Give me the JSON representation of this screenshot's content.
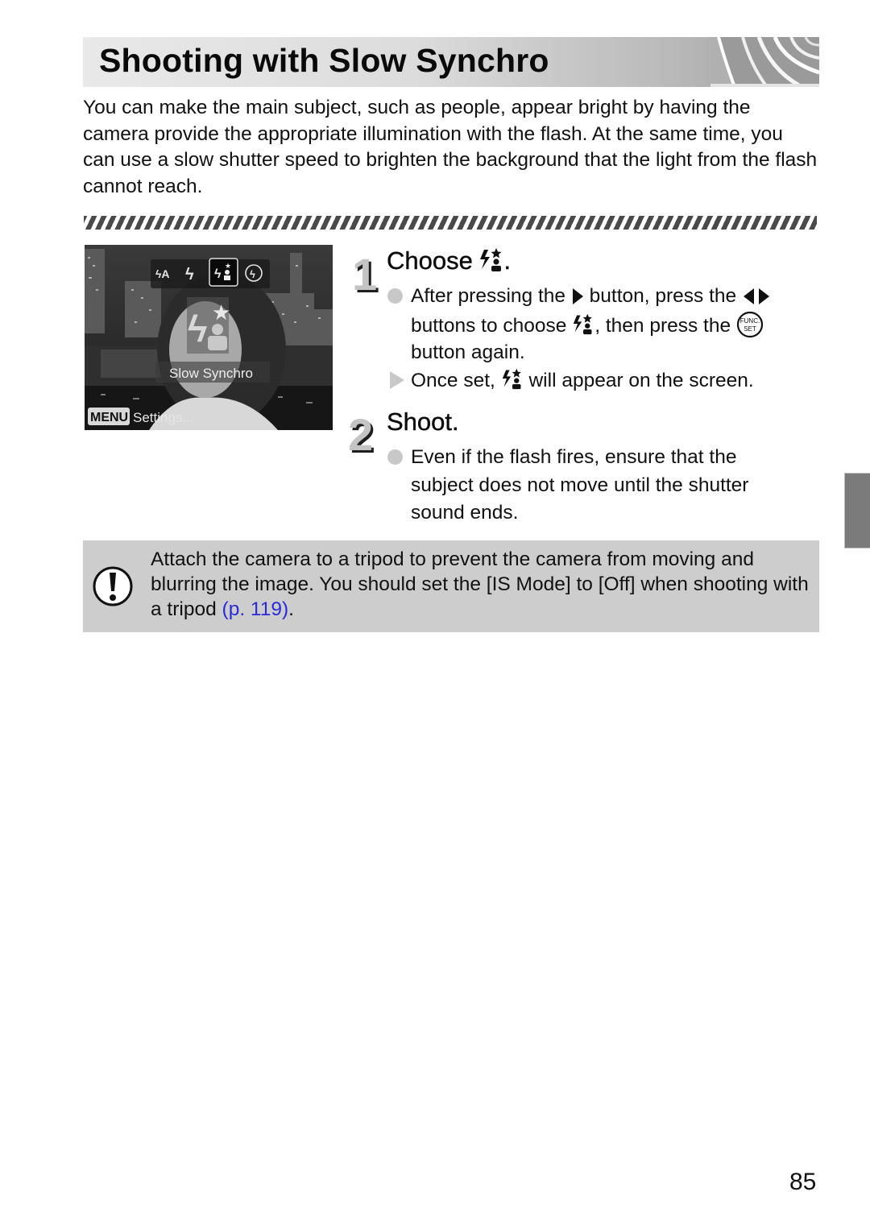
{
  "header": {
    "title": "Shooting with Slow Synchro"
  },
  "intro": {
    "text": "You can make the main subject, such as people, appear bright by having the camera provide the appropriate illumination with the flash. At the same time, you can use a slow shutter speed to brighten the background that the light from the flash cannot reach."
  },
  "camera_screen": {
    "flash_modes": [
      "auto-flash-icon",
      "flash-on-icon",
      "slow-synchro-icon",
      "flash-off-icon"
    ],
    "selected_mode": "slow-synchro-icon",
    "mode_label": "Slow Synchro",
    "menu_key": "MENU",
    "menu_hint": "Settings..."
  },
  "steps": [
    {
      "number": "1",
      "title": "Choose",
      "title_suffix": ".",
      "line1_a": "After pressing the",
      "line1_b": "button, press the",
      "line2_a": "buttons to choose",
      "line2_b": ", then press the",
      "line3": "button again.",
      "result_a": "Once set,",
      "result_b": "will appear on the screen.",
      "func_button_top": "FUNC.",
      "func_button_bottom": "SET"
    },
    {
      "number": "2",
      "title": "Shoot.",
      "line1": "Even if the flash fires, ensure that the",
      "line2": "subject does not move until the shutter",
      "line3": "sound ends."
    }
  ],
  "caution": {
    "text": "Attach the camera to a tripod to prevent the camera from moving and blurring the image. You should set the [IS Mode] to [Off] when shooting with a tripod ",
    "link": "(p. 119)",
    "suffix": "."
  },
  "page": {
    "number": "85"
  },
  "colors": {
    "link": "#2a2ad8",
    "caution_bg": "#cdcdcd",
    "side_tab": "#7b7b7b"
  }
}
